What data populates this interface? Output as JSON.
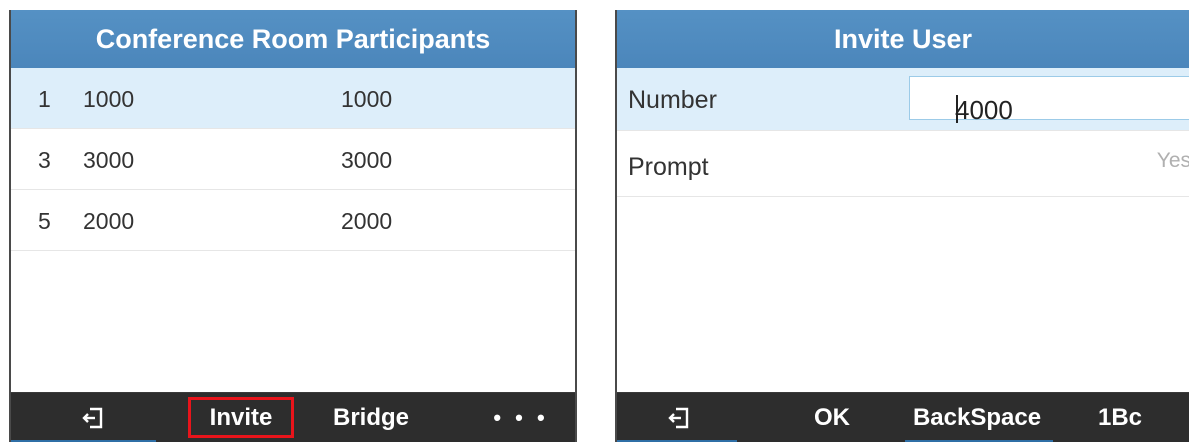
{
  "left_screen": {
    "title": "Conference Room Participants",
    "participants": [
      {
        "index": "1",
        "number": "1000",
        "name": "1000",
        "selected": true
      },
      {
        "index": "3",
        "number": "3000",
        "name": "3000",
        "selected": false
      },
      {
        "index": "5",
        "number": "2000",
        "name": "2000",
        "selected": false
      }
    ],
    "softkeys": {
      "exit_icon": "exit-icon",
      "invite": "Invite",
      "bridge": "Bridge",
      "more": "• • •"
    }
  },
  "right_screen": {
    "title": "Invite User",
    "number_label": "Number",
    "number_value": "4000",
    "prompt_label": "Prompt",
    "prompt_value": "Yes",
    "softkeys": {
      "exit_icon": "exit-icon",
      "ok": "OK",
      "backspace": "BackSpace",
      "input_mode": "1Bc"
    }
  },
  "colors": {
    "title_bar": "#4b86bb",
    "selected_row": "#ddeefa",
    "softkey_bar": "#2d2d2d",
    "highlight_border": "#e8141b"
  }
}
